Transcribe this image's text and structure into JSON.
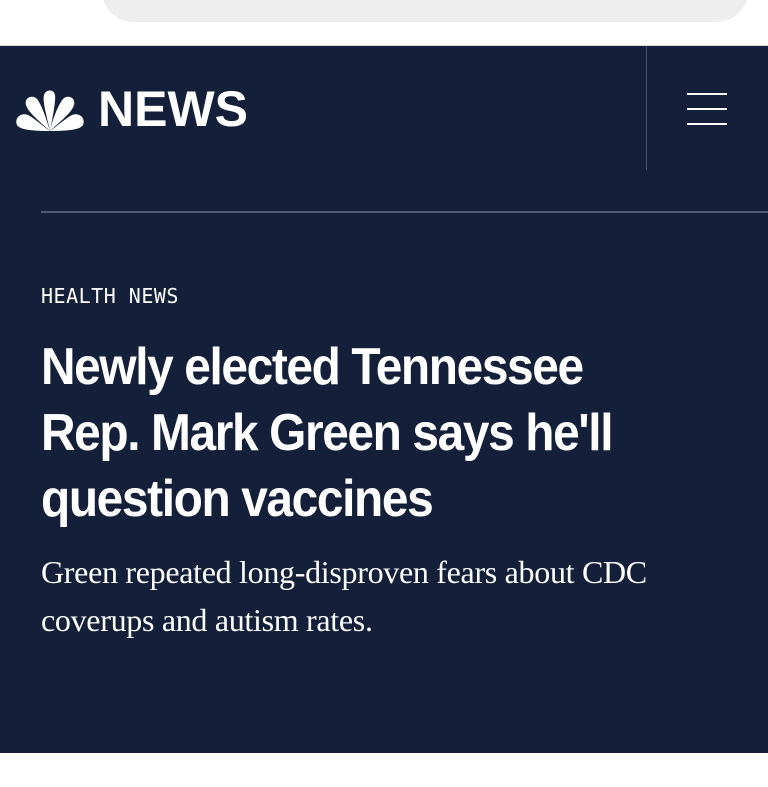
{
  "header": {
    "logo_text": "NEWS",
    "logo_icon": "peacock-icon",
    "menu_icon": "hamburger-menu-icon"
  },
  "article": {
    "section": "HEALTH NEWS",
    "headline": "Newly elected Tennessee Rep. Mark Green says he'll question vaccines",
    "dek": "Green repeated long-disproven fears about CDC coverups and autism rates."
  },
  "colors": {
    "masthead_background": "#142039",
    "text": "#ffffff",
    "divider": "#505a70"
  }
}
